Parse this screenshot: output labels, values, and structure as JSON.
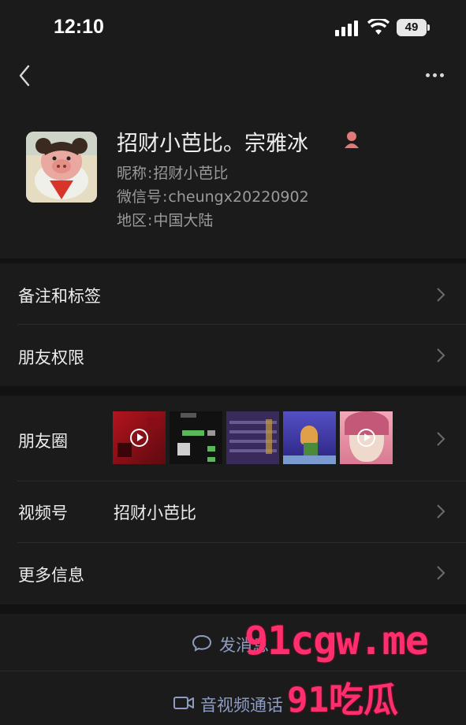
{
  "status_bar": {
    "time": "12:10",
    "battery": "49"
  },
  "profile": {
    "name": "招财小芭比。宗雅冰",
    "nickname_label": "昵称",
    "nickname": "招财小芭比",
    "wechat_id_label": "微信号",
    "wechat_id": "cheungx20220902",
    "region_label": "地区",
    "region": "中国大陆",
    "gender_icon": "female-icon"
  },
  "rows": {
    "remarks": "备注和标签",
    "permissions": "朋友权限",
    "moments": "朋友圈",
    "channels_label": "视频号",
    "channels_value": "招财小芭比",
    "more_info": "更多信息"
  },
  "actions": {
    "message": "发消息",
    "call": "音视频通话"
  },
  "watermark": {
    "line1": "91cgw.me",
    "line2": "91吃瓜"
  },
  "colors": {
    "background": "#1b1b1b",
    "section_gap": "#121212",
    "action_text": "#8e9cc4",
    "watermark": "#ff2f6e"
  }
}
